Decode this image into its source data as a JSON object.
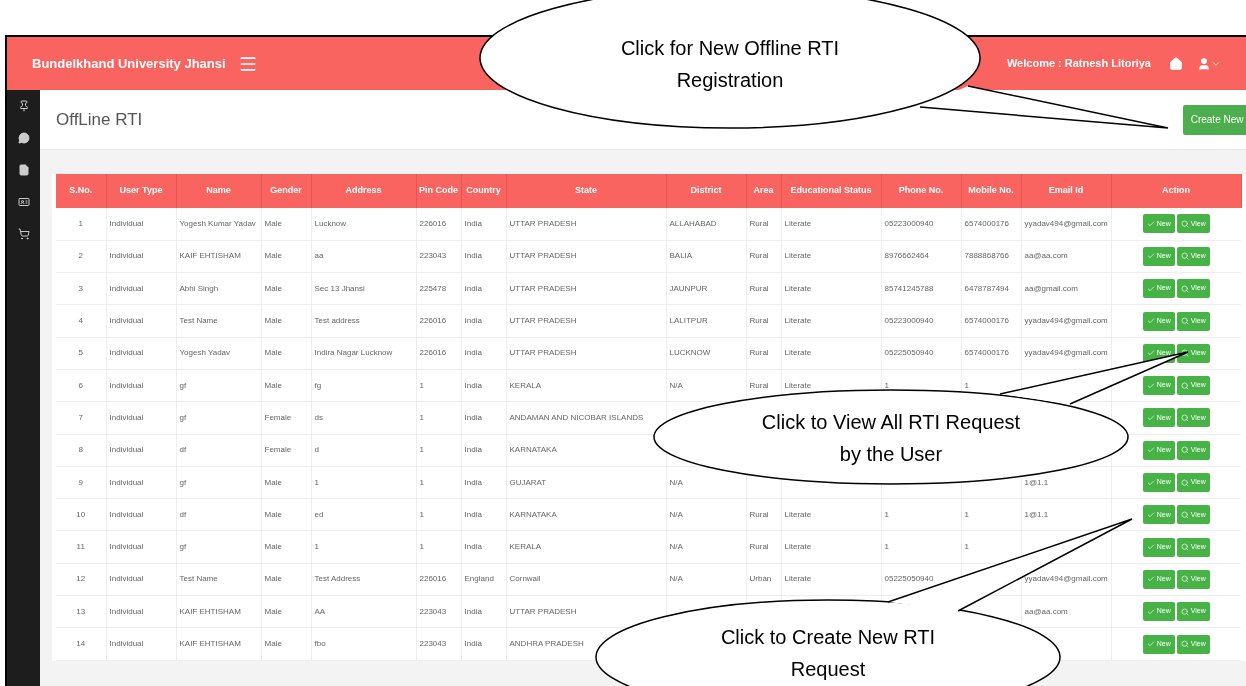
{
  "header": {
    "brand": "Bundelkhand University Jhansi",
    "welcome": "Welcome : Ratnesh Litoriya"
  },
  "page": {
    "title": "OffLine RTI",
    "create_button": "Create New"
  },
  "table": {
    "columns": [
      "S.No.",
      "User Type",
      "Name",
      "Gender",
      "Address",
      "Pin Code",
      "Country",
      "State",
      "District",
      "Area",
      "Educational Status",
      "Phone No.",
      "Mobile No.",
      "Email Id",
      "Action"
    ],
    "rows": [
      {
        "sno": "1",
        "user_type": "Individual",
        "name": "Yogesh Kumar Yadav",
        "gender": "Male",
        "address": "Lucknow",
        "pin_code": "226016",
        "country": "India",
        "state": "UTTAR PRADESH",
        "district": "ALLAHABAD",
        "area": "Rural",
        "educational_status": "Literate",
        "phone_no": "05223000940",
        "mobile_no": "6574000176",
        "email_id": "yyadav494@gmail.com",
        "actions": [
          "New",
          "View"
        ]
      },
      {
        "sno": "2",
        "user_type": "Individual",
        "name": "KAIF EHTISHAM",
        "gender": "Male",
        "address": "aa",
        "pin_code": "223043",
        "country": "India",
        "state": "UTTAR PRADESH",
        "district": "BALIA",
        "area": "Rural",
        "educational_status": "Literate",
        "phone_no": "8976662464",
        "mobile_no": "7888868766",
        "email_id": "aa@aa.com",
        "actions": [
          "New",
          "View"
        ]
      },
      {
        "sno": "3",
        "user_type": "Individual",
        "name": "Abhi Singh",
        "gender": "Male",
        "address": "Sec 13 Jhansi",
        "pin_code": "225478",
        "country": "India",
        "state": "UTTAR PRADESH",
        "district": "JAUNPUR",
        "area": "Rural",
        "educational_status": "Literate",
        "phone_no": "85741245788",
        "mobile_no": "6478787494",
        "email_id": "aa@gmail.com",
        "actions": [
          "New",
          "View"
        ]
      },
      {
        "sno": "4",
        "user_type": "Individual",
        "name": "Test Name",
        "gender": "Male",
        "address": "Test address",
        "pin_code": "226016",
        "country": "India",
        "state": "UTTAR PRADESH",
        "district": "LALITPUR",
        "area": "Rural",
        "educational_status": "Literate",
        "phone_no": "05223000940",
        "mobile_no": "6574000176",
        "email_id": "yyadav494@gmail.com",
        "actions": [
          "New",
          "View"
        ]
      },
      {
        "sno": "5",
        "user_type": "Individual",
        "name": "Yogesh Yadav",
        "gender": "Male",
        "address": "Indira Nagar Lucknow",
        "pin_code": "226016",
        "country": "India",
        "state": "UTTAR PRADESH",
        "district": "LUCKNOW",
        "area": "Rural",
        "educational_status": "Literate",
        "phone_no": "05225050940",
        "mobile_no": "6574000176",
        "email_id": "yyadav494@gmail.com",
        "actions": [
          "New",
          "View"
        ]
      },
      {
        "sno": "6",
        "user_type": "Individual",
        "name": "gf",
        "gender": "Male",
        "address": "fg",
        "pin_code": "1",
        "country": "India",
        "state": "KERALA",
        "district": "N/A",
        "area": "Rural",
        "educational_status": "Literate",
        "phone_no": "1",
        "mobile_no": "1",
        "actions": [
          "New",
          "View"
        ]
      },
      {
        "sno": "7",
        "user_type": "Individual",
        "name": "gf",
        "gender": "Female",
        "address": "ds",
        "pin_code": "1",
        "country": "India",
        "state": "ANDAMAN AND NICOBAR ISLANDS",
        "actions": [
          "New",
          "View"
        ]
      },
      {
        "sno": "8",
        "user_type": "Individual",
        "name": "df",
        "gender": "Female",
        "address": "d",
        "pin_code": "1",
        "country": "India",
        "state": "KARNATAKA",
        "actions": [
          "New",
          "View"
        ]
      },
      {
        "sno": "9",
        "user_type": "Individual",
        "name": "gf",
        "gender": "Male",
        "address": "1",
        "pin_code": "1",
        "country": "India",
        "state": "GUJARAT",
        "district": "N/A",
        "email_id": "1@1.1",
        "actions": [
          "New",
          "View"
        ]
      },
      {
        "sno": "10",
        "user_type": "Individual",
        "name": "df",
        "gender": "Male",
        "address": "ed",
        "pin_code": "1",
        "country": "India",
        "state": "KARNATAKA",
        "district": "N/A",
        "area": "Rural",
        "educational_status": "Literate",
        "phone_no": "1",
        "mobile_no": "1",
        "email_id": "1@1.1",
        "actions": [
          "New",
          "View"
        ]
      },
      {
        "sno": "11",
        "user_type": "Individual",
        "name": "gf",
        "gender": "Male",
        "address": "1",
        "pin_code": "1",
        "country": "India",
        "state": "KERALA",
        "district": "N/A",
        "area": "Rural",
        "educational_status": "Literate",
        "phone_no": "1",
        "mobile_no": "1",
        "actions": [
          "New",
          "View"
        ]
      },
      {
        "sno": "12",
        "user_type": "Individual",
        "name": "Test Name",
        "gender": "Male",
        "address": "Test Address",
        "pin_code": "226016",
        "country": "England",
        "state": "Cornwall",
        "district": "N/A",
        "area": "Urban",
        "educational_status": "Literate",
        "phone_no": "05225050940",
        "email_id": "yyadav494@gmail.com",
        "actions": [
          "New",
          "View"
        ]
      },
      {
        "sno": "13",
        "user_type": "Individual",
        "name": "KAIF EHTISHAM",
        "gender": "Male",
        "address": "AA",
        "pin_code": "223043",
        "country": "India",
        "state": "UTTAR PRADESH",
        "email_id": "aa@aa.com",
        "actions": [
          "New",
          "View"
        ]
      },
      {
        "sno": "14",
        "user_type": "Individual",
        "name": "KAIF EHTISHAM",
        "gender": "Male",
        "address": "fbo",
        "pin_code": "223043",
        "country": "India",
        "state": "ANDHRA PRADESH",
        "actions": [
          "New",
          "View"
        ]
      }
    ]
  },
  "callouts": [
    {
      "text": "Click for New Offline RTI Registration"
    },
    {
      "text": "Click to View All RTI Request by the User"
    },
    {
      "text": "Click to Create New RTI Request"
    }
  ]
}
